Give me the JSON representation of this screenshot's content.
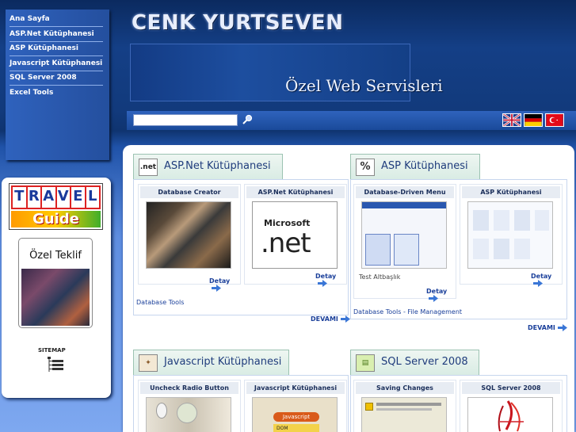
{
  "header": {
    "site_title": "CENK YURTSEVEN",
    "subtitle": "Özel Web Servisleri"
  },
  "search": {
    "value": "",
    "placeholder": ""
  },
  "languages": [
    "english-flag",
    "german-flag",
    "turkish-flag"
  ],
  "nav": {
    "items": [
      "Ana Sayfa",
      "ASP.Net Kütüphanesi",
      "ASP Kütüphanesi",
      "Javascript Kütüphanesi",
      "SQL Server 2008",
      "Excel Tools"
    ]
  },
  "left": {
    "travel_top": [
      "T",
      "R",
      "A",
      "V",
      "E",
      "L"
    ],
    "travel_bottom": "Guide",
    "ozel_title": "Özel Teklif",
    "sitemap": "SITEMAP"
  },
  "sections": [
    {
      "title": "ASP.Net Kütüphanesi",
      "icon": "net",
      "cards": [
        {
          "title": "Database Creator",
          "link": "Detay"
        },
        {
          "title": "ASP.Net Kütüphanesi",
          "link": "Detay"
        }
      ],
      "caption": "Database Tools",
      "more": "DEVAMI"
    },
    {
      "title": "ASP Kütüphanesi",
      "icon": "%",
      "cards": [
        {
          "title": "Database-Driven Menu",
          "link": "Detay",
          "extra": "Test Altbaşlık"
        },
        {
          "title": "ASP Kütüphanesi",
          "link": "Detay"
        }
      ],
      "caption": "Database Tools - File Management",
      "more": "DEVAMI"
    },
    {
      "title": "Javascript Kütüphanesi",
      "cards": [
        {
          "title": "Uncheck Radio Button"
        },
        {
          "title": "Javascript Kütüphanesi",
          "img_text": "Javascript",
          "img_text2": "DOM"
        }
      ]
    },
    {
      "title": "SQL Server 2008",
      "cards": [
        {
          "title": "Saving Changes"
        },
        {
          "title": "SQL Server 2008"
        }
      ]
    }
  ],
  "net_logo": {
    "brand": "Microsoft",
    "big": ".net"
  },
  "colors": {
    "link": "#1a3f9a",
    "tab_bg": "#e1f0ea",
    "nav_bg": "#2f62bd"
  }
}
